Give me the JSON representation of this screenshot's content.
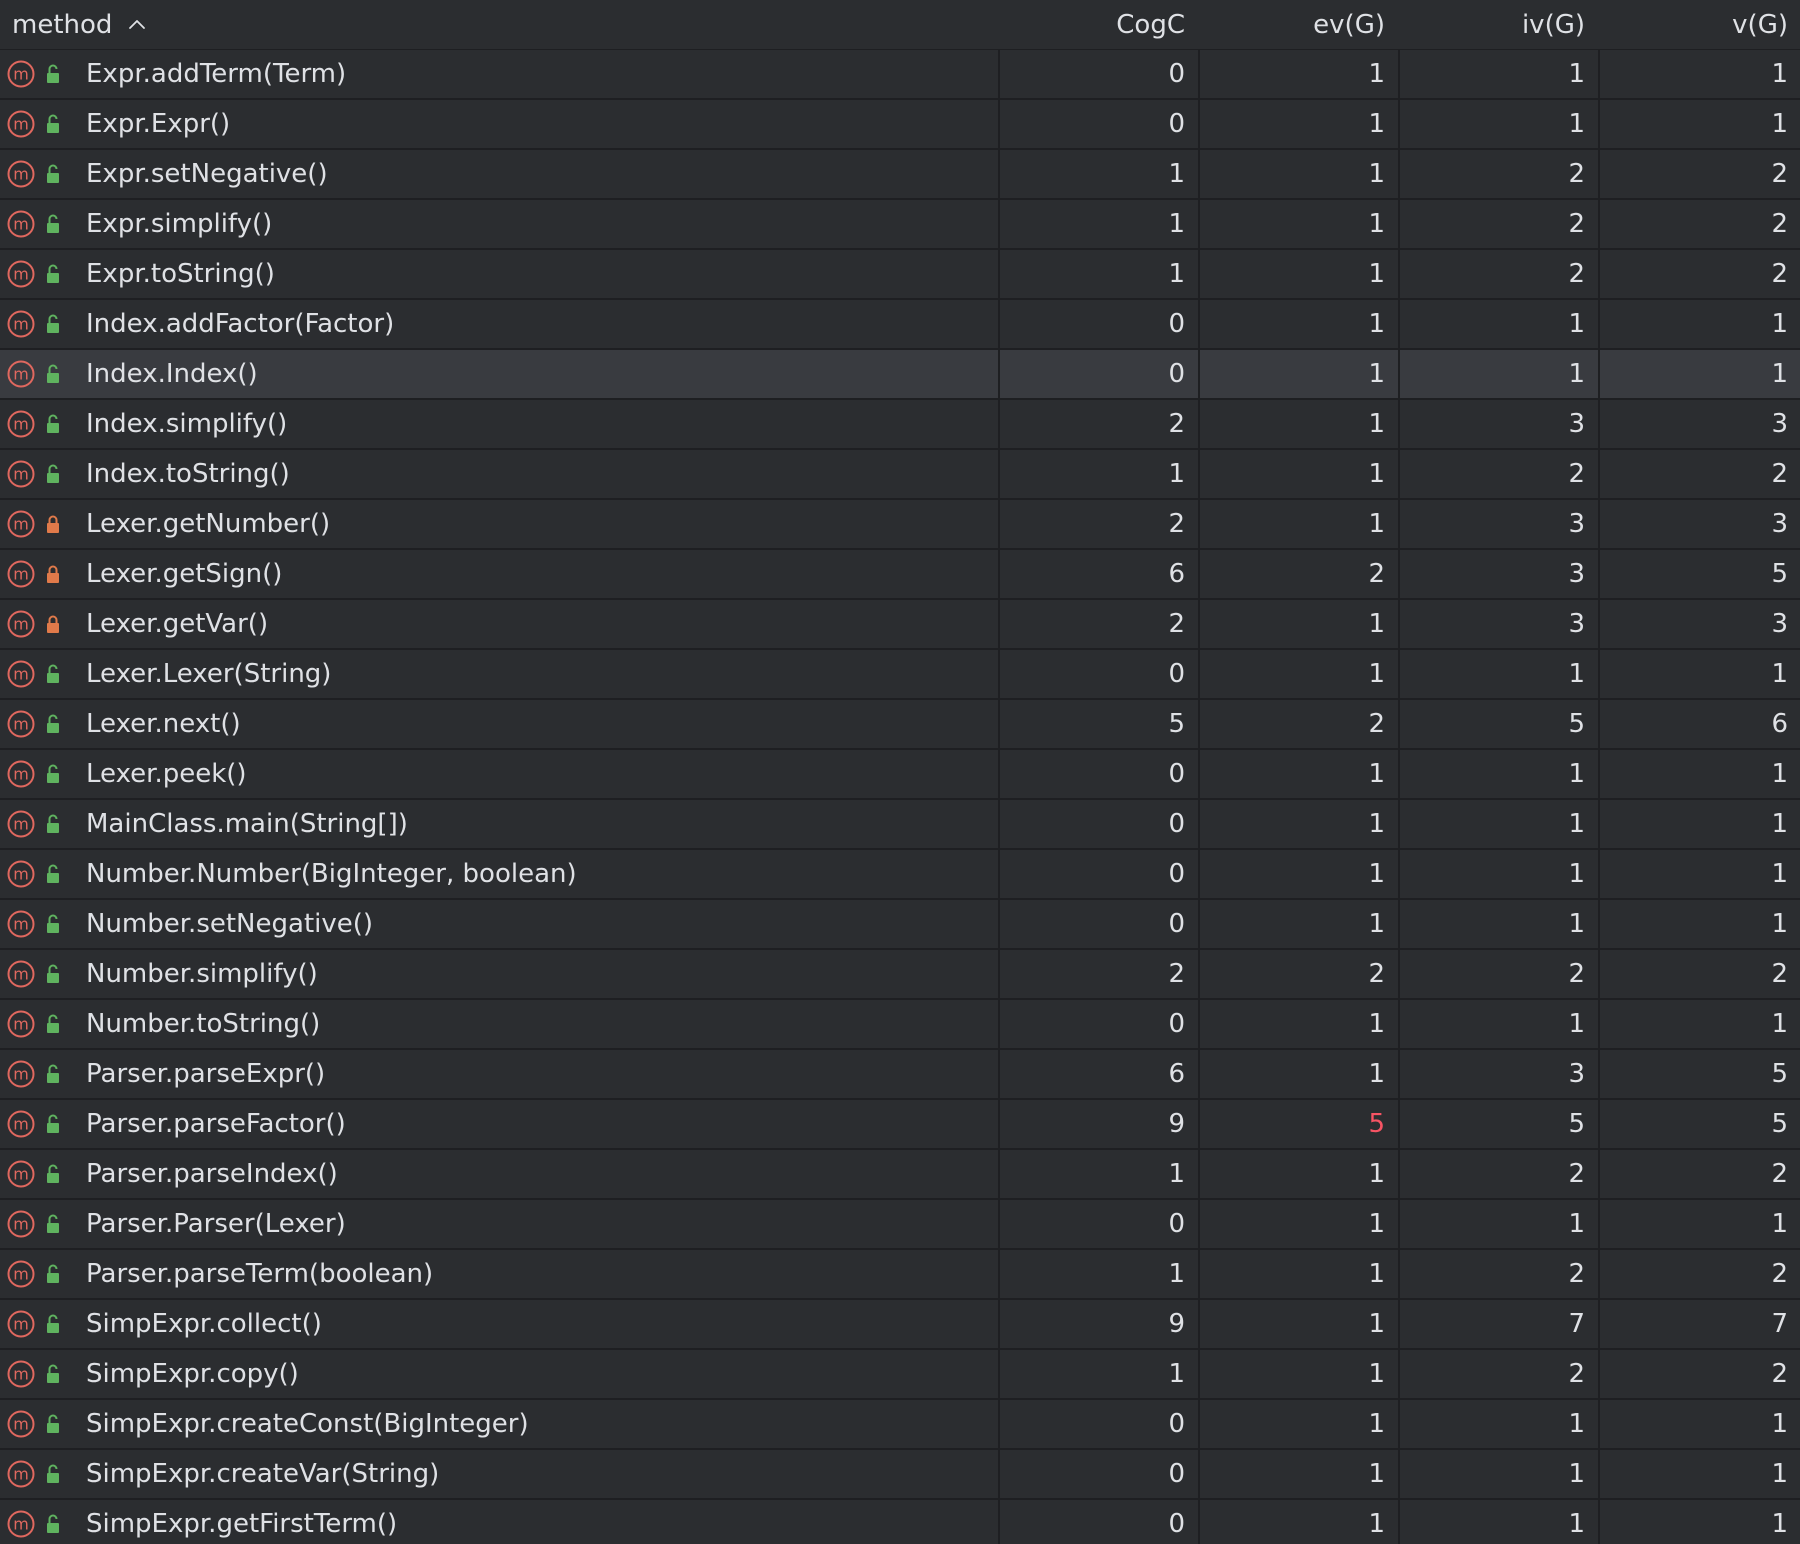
{
  "header": {
    "method": "method",
    "cogc": "CogC",
    "ev": "ev(G)",
    "iv": "iv(G)",
    "v": "v(G)",
    "sort_icon": "chevron-up-icon"
  },
  "colors": {
    "background": "#2b2d30",
    "selected_row": "#393b40",
    "separator": "#1e1f22",
    "text": "#dfe1e5",
    "method_icon": "#e0685f",
    "public_lock": "#5fb35f",
    "private_lock": "#e07a4a",
    "warning_value": "#f75464"
  },
  "rows": [
    {
      "name": "Expr.addTerm(Term)",
      "access": "public",
      "cogc": "0",
      "ev": "1",
      "iv": "1",
      "v": "1"
    },
    {
      "name": "Expr.Expr()",
      "access": "public",
      "cogc": "0",
      "ev": "1",
      "iv": "1",
      "v": "1"
    },
    {
      "name": "Expr.setNegative()",
      "access": "public",
      "cogc": "1",
      "ev": "1",
      "iv": "2",
      "v": "2"
    },
    {
      "name": "Expr.simplify()",
      "access": "public",
      "cogc": "1",
      "ev": "1",
      "iv": "2",
      "v": "2"
    },
    {
      "name": "Expr.toString()",
      "access": "public",
      "cogc": "1",
      "ev": "1",
      "iv": "2",
      "v": "2"
    },
    {
      "name": "Index.addFactor(Factor)",
      "access": "public",
      "cogc": "0",
      "ev": "1",
      "iv": "1",
      "v": "1"
    },
    {
      "name": "Index.Index()",
      "access": "public",
      "cogc": "0",
      "ev": "1",
      "iv": "1",
      "v": "1",
      "selected": true
    },
    {
      "name": "Index.simplify()",
      "access": "public",
      "cogc": "2",
      "ev": "1",
      "iv": "3",
      "v": "3"
    },
    {
      "name": "Index.toString()",
      "access": "public",
      "cogc": "1",
      "ev": "1",
      "iv": "2",
      "v": "2"
    },
    {
      "name": "Lexer.getNumber()",
      "access": "private",
      "cogc": "2",
      "ev": "1",
      "iv": "3",
      "v": "3"
    },
    {
      "name": "Lexer.getSign()",
      "access": "private",
      "cogc": "6",
      "ev": "2",
      "iv": "3",
      "v": "5"
    },
    {
      "name": "Lexer.getVar()",
      "access": "private",
      "cogc": "2",
      "ev": "1",
      "iv": "3",
      "v": "3"
    },
    {
      "name": "Lexer.Lexer(String)",
      "access": "public",
      "cogc": "0",
      "ev": "1",
      "iv": "1",
      "v": "1"
    },
    {
      "name": "Lexer.next()",
      "access": "public",
      "cogc": "5",
      "ev": "2",
      "iv": "5",
      "v": "6"
    },
    {
      "name": "Lexer.peek()",
      "access": "public",
      "cogc": "0",
      "ev": "1",
      "iv": "1",
      "v": "1"
    },
    {
      "name": "MainClass.main(String[])",
      "access": "public",
      "cogc": "0",
      "ev": "1",
      "iv": "1",
      "v": "1"
    },
    {
      "name": "Number.Number(BigInteger, boolean)",
      "access": "public",
      "cogc": "0",
      "ev": "1",
      "iv": "1",
      "v": "1"
    },
    {
      "name": "Number.setNegative()",
      "access": "public",
      "cogc": "0",
      "ev": "1",
      "iv": "1",
      "v": "1"
    },
    {
      "name": "Number.simplify()",
      "access": "public",
      "cogc": "2",
      "ev": "2",
      "iv": "2",
      "v": "2"
    },
    {
      "name": "Number.toString()",
      "access": "public",
      "cogc": "0",
      "ev": "1",
      "iv": "1",
      "v": "1"
    },
    {
      "name": "Parser.parseExpr()",
      "access": "public",
      "cogc": "6",
      "ev": "1",
      "iv": "3",
      "v": "5"
    },
    {
      "name": "Parser.parseFactor()",
      "access": "public",
      "cogc": "9",
      "ev": "5",
      "iv": "5",
      "v": "5",
      "ev_warn": true
    },
    {
      "name": "Parser.parseIndex()",
      "access": "public",
      "cogc": "1",
      "ev": "1",
      "iv": "2",
      "v": "2"
    },
    {
      "name": "Parser.Parser(Lexer)",
      "access": "public",
      "cogc": "0",
      "ev": "1",
      "iv": "1",
      "v": "1"
    },
    {
      "name": "Parser.parseTerm(boolean)",
      "access": "public",
      "cogc": "1",
      "ev": "1",
      "iv": "2",
      "v": "2"
    },
    {
      "name": "SimpExpr.collect()",
      "access": "public",
      "cogc": "9",
      "ev": "1",
      "iv": "7",
      "v": "7"
    },
    {
      "name": "SimpExpr.copy()",
      "access": "public",
      "cogc": "1",
      "ev": "1",
      "iv": "2",
      "v": "2"
    },
    {
      "name": "SimpExpr.createConst(BigInteger)",
      "access": "public",
      "cogc": "0",
      "ev": "1",
      "iv": "1",
      "v": "1"
    },
    {
      "name": "SimpExpr.createVar(String)",
      "access": "public",
      "cogc": "0",
      "ev": "1",
      "iv": "1",
      "v": "1"
    },
    {
      "name": "SimpExpr.getFirstTerm()",
      "access": "public",
      "cogc": "0",
      "ev": "1",
      "iv": "1",
      "v": "1"
    }
  ]
}
